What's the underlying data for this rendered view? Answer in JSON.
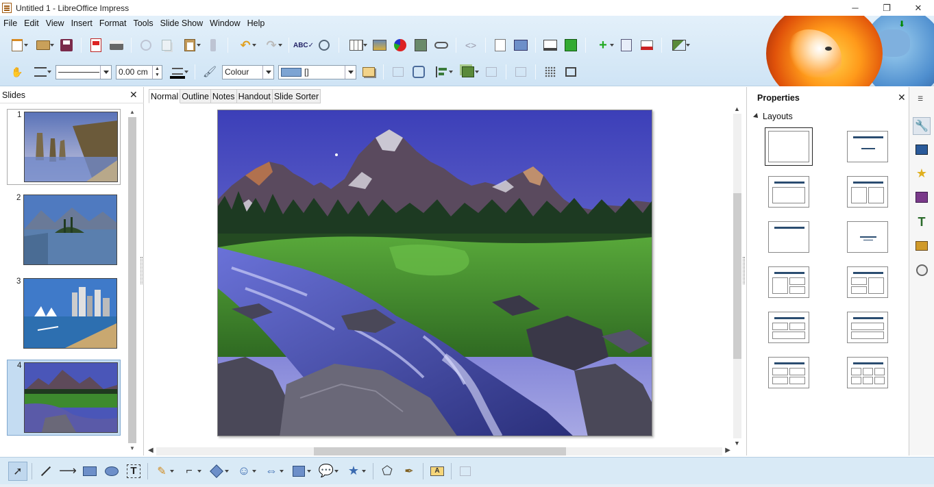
{
  "window": {
    "title": "Untitled 1 - LibreOffice Impress",
    "controls": {
      "minimize": "─",
      "maximize": "❐",
      "close": "✕"
    }
  },
  "menubar": {
    "items": [
      "File",
      "Edit",
      "View",
      "Insert",
      "Format",
      "Tools",
      "Slide Show",
      "Window",
      "Help"
    ]
  },
  "toolbar_standard": {
    "icons": [
      "new-icon",
      "open-icon",
      "save-icon",
      "export-pdf-icon",
      "print-icon",
      "cut-icon",
      "copy-icon",
      "paste-icon",
      "clone-formatting-icon",
      "undo-icon",
      "redo-icon",
      "spelling-icon",
      "find-replace-icon",
      "table-icon",
      "image-icon",
      "chart-icon",
      "media-icon",
      "fontwork-icon",
      "hyperlink-icon",
      "show-draw-functions-icon",
      "insert-textbox-icon",
      "start-slideshow-icon",
      "start-from-current-icon",
      "new-slide-icon",
      "duplicate-slide-icon",
      "delete-slide-icon",
      "slide-layout-icon"
    ]
  },
  "toolbar_line_fill": {
    "line_width_value": "0.00 cm",
    "area_style_value": "Colour",
    "fill_color_value": "[]",
    "colors": {
      "fill_swatch": "#7da4d3",
      "line_color": "#000000"
    }
  },
  "slides_panel": {
    "title": "Slides",
    "close": "✕",
    "slides": [
      {
        "number": "1",
        "scene": "coastal-sea-stacks"
      },
      {
        "number": "2",
        "scene": "mountain-lake-island"
      },
      {
        "number": "3",
        "scene": "city-harbour"
      },
      {
        "number": "4",
        "scene": "mountain-stream"
      }
    ],
    "selected_slide": "4"
  },
  "view_tabs": {
    "items": [
      "Normal",
      "Outline",
      "Notes",
      "Handout",
      "Slide Sorter"
    ],
    "active": "Normal"
  },
  "properties_panel": {
    "title": "Properties",
    "close": "✕",
    "section_title": "Layouts",
    "layouts": [
      "blank",
      "title-content",
      "title-only",
      "title-two-content",
      "title-only-centered",
      "centered-text",
      "title-content-two",
      "title-two-content-split",
      "title-four-content",
      "title-two-rows",
      "title-four-grid",
      "title-six-content"
    ]
  },
  "sidebar_deck": {
    "icons": [
      "sidebar-menu-icon",
      "properties-wrench-icon",
      "master-slides-icon",
      "custom-animation-star-icon",
      "slide-transition-icon",
      "styles-icon",
      "gallery-icon",
      "navigator-icon"
    ]
  },
  "drawing_toolbar": {
    "icons": [
      "select-arrow-icon",
      "line-icon",
      "line-arrow-icon",
      "rectangle-icon",
      "ellipse-icon",
      "text-box-icon",
      "line-color-pencil-icon",
      "connector-icon",
      "basic-shapes-diamond-icon",
      "symbol-shapes-smiley-icon",
      "block-arrows-icon",
      "flowchart-icon",
      "callouts-icon",
      "stars-icon",
      "points-icon",
      "bezier-pencil-icon",
      "fontwork-gallery-icon",
      "3d-objects-icon"
    ]
  }
}
